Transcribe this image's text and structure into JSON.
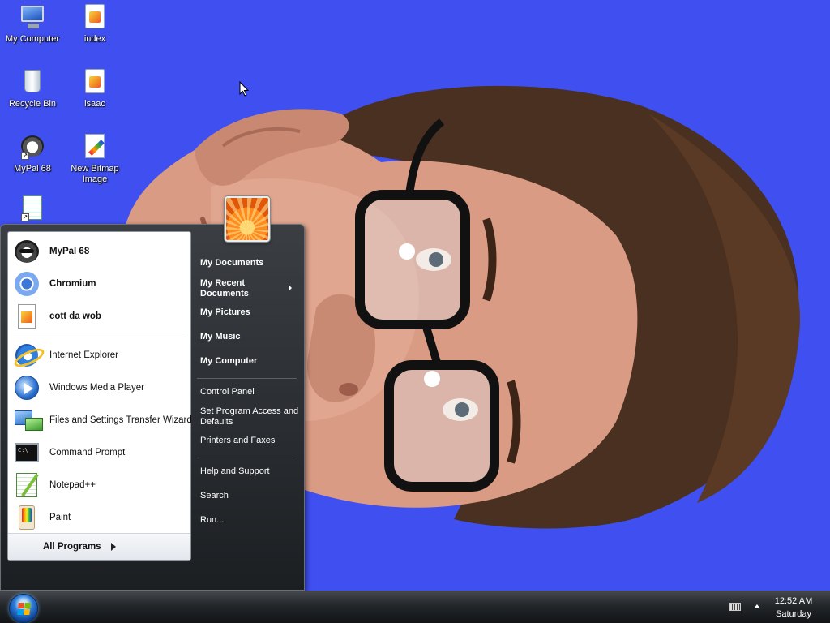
{
  "desktop": {
    "icons": [
      {
        "label": "My Computer",
        "icon": "my-computer-icon"
      },
      {
        "label": "index",
        "icon": "image-file-icon"
      },
      {
        "label": "Recycle Bin",
        "icon": "recycle-bin-icon"
      },
      {
        "label": "isaac",
        "icon": "image-file-icon"
      },
      {
        "label": "MyPal 68",
        "icon": "mypal-icon"
      },
      {
        "label": "New Bitmap Image",
        "icon": "bitmap-file-icon"
      },
      {
        "label": "",
        "icon": "notepad-plus-plus-icon"
      }
    ]
  },
  "start_menu": {
    "pinned": [
      {
        "label": "MyPal 68",
        "icon": "mypal-icon"
      },
      {
        "label": "Chromium",
        "icon": "chromium-icon"
      },
      {
        "label": "cott da wob",
        "icon": "image-file-icon"
      }
    ],
    "recent": [
      {
        "label": "Internet Explorer",
        "icon": "internet-explorer-icon"
      },
      {
        "label": "Windows Media Player",
        "icon": "windows-media-player-icon"
      },
      {
        "label": "Files and Settings Transfer Wizard",
        "icon": "transfer-wizard-icon"
      },
      {
        "label": "Command Prompt",
        "icon": "command-prompt-icon"
      },
      {
        "label": "Notepad++",
        "icon": "notepad-plus-plus-icon"
      },
      {
        "label": "Paint",
        "icon": "paint-icon"
      }
    ],
    "all_programs_label": "All Programs",
    "right": {
      "places": [
        "My Documents",
        "My Recent Documents",
        "My Pictures",
        "My Music",
        "My Computer"
      ],
      "system": [
        "Control Panel",
        "Set Program Access and Defaults",
        "Printers and Faxes"
      ],
      "help": [
        "Help and Support",
        "Search",
        "Run..."
      ]
    }
  },
  "taskbar": {
    "clock_time": "12:52 AM",
    "clock_day": "Saturday"
  },
  "colors": {
    "desktop_background": "#3f4ff0",
    "start_menu_dark": "#1c1f22",
    "taskbar": "#23272a"
  }
}
